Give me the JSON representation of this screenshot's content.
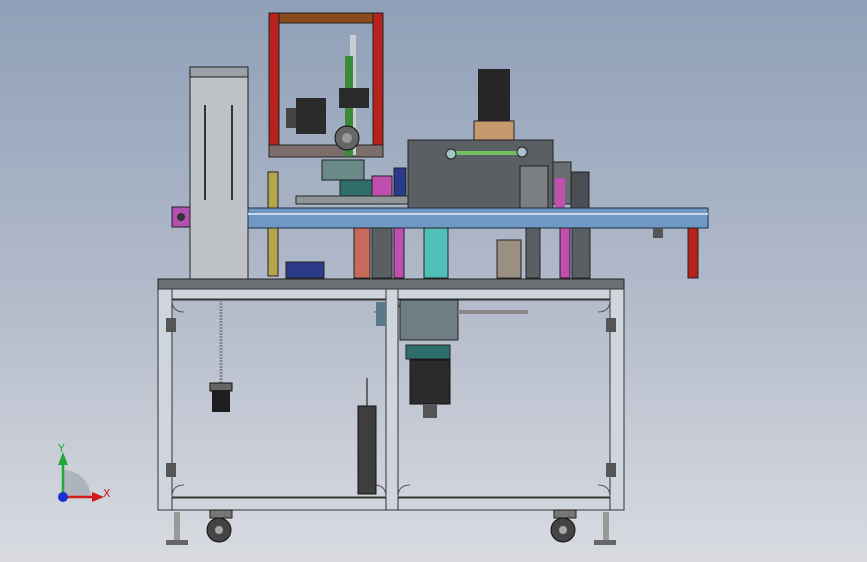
{
  "viewport": {
    "background_top": "#8fa0b8",
    "background_bottom": "#d9dbe1"
  },
  "triad": {
    "x_label": "X",
    "y_label": "Y",
    "x_color": "#d11a1a",
    "y_color": "#22a83a",
    "z_color": "#1a2fd1"
  },
  "colors": {
    "frame_aluminum": "#c9cfd6",
    "tower_red": "#b8221c",
    "tower_top": "#8a4a1c",
    "rail_blue": "#6f98c4",
    "housing": "#5a5f64",
    "motor": "#2a2a2a",
    "accent_pink": "#c050b0",
    "accent_teal": "#50c0b8",
    "accent_green": "#70c060"
  }
}
